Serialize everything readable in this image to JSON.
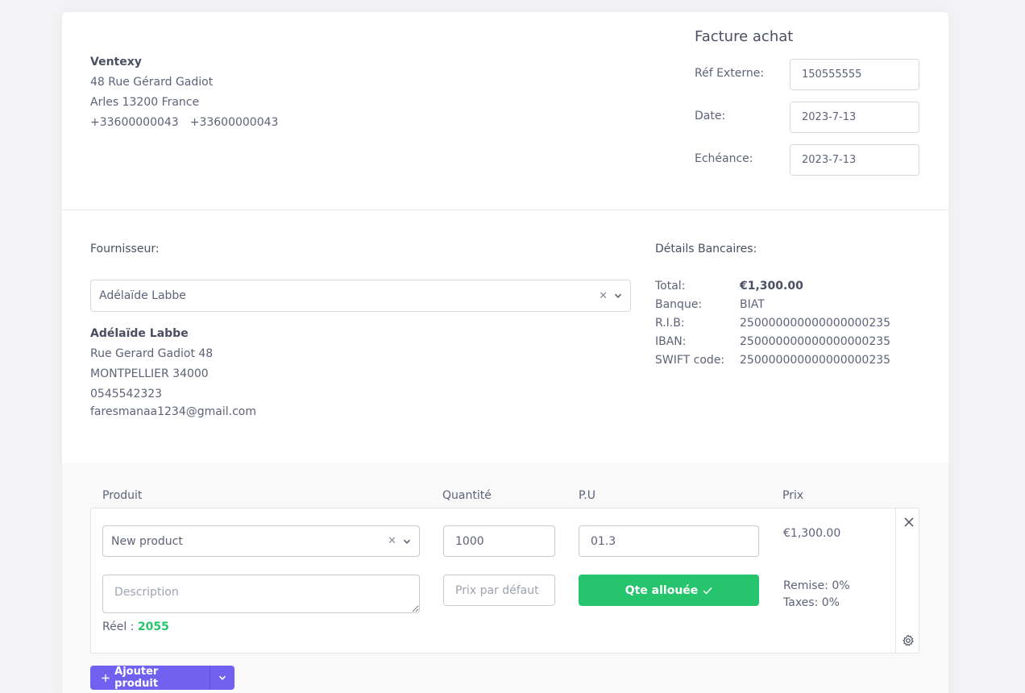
{
  "company": {
    "name": "Ventexy",
    "address": "48 Rue Gérard Gadiot",
    "city": "Arles 13200 France",
    "phone1": "+33600000043",
    "phone2": "+33600000043"
  },
  "invoice": {
    "title": "Facture achat",
    "ref_label": "Réf Externe:",
    "ref_value": "150555555",
    "date_label": "Date:",
    "date_value": "2023-7-13",
    "due_label": "Echéance:",
    "due_value": "2023-7-13"
  },
  "supplier": {
    "section_label": "Fournisseur:",
    "selected": "Adélaïde Labbe",
    "name": "Adélaïde Labbe",
    "address": "Rue Gerard Gadiot 48",
    "city": "MONTPELLIER 34000",
    "phone": "0545542323",
    "email": "faresmanaa1234@gmail.com"
  },
  "bank": {
    "section_label": "Détails Bancaires:",
    "total_label": "Total:",
    "total_value": "€1,300.00",
    "bank_label": "Banque:",
    "bank_value": "BIAT",
    "rib_label": "R.I.B:",
    "rib_value": "250000000000000000235",
    "iban_label": "IBAN:",
    "iban_value": "250000000000000000235",
    "swift_label": "SWIFT code:",
    "swift_value": "250000000000000000235"
  },
  "products": {
    "headers": {
      "product": "Produit",
      "quantity": "Quantité",
      "unit_price": "P.U",
      "price": "Prix"
    },
    "line": {
      "product": "New product",
      "quantity": "1000",
      "unit_price": "01.3",
      "price": "€1,300.00",
      "description_placeholder": "Description",
      "default_price_placeholder": "Prix par défaut",
      "allocated_button": "Qte allouée",
      "reel_label": "Réel :",
      "reel_value": "2055",
      "remise": "Remise: 0%",
      "taxes": "Taxes: 0%"
    },
    "add_button": "Ajouter produit"
  },
  "colors": {
    "accent": "#7061f0",
    "success": "#27c46e"
  }
}
